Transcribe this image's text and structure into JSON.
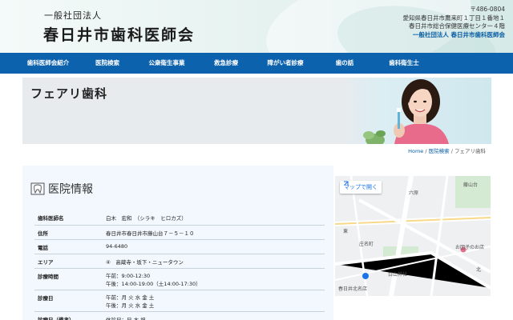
{
  "header": {
    "org_sub": "一般社団法人",
    "org_name": "春日井市歯科医師会",
    "postal": "〒486-0804",
    "address1": "愛知県春日井市鷹来町１丁目１番地１",
    "address2": "春日井市総合保健医療センター４階",
    "address_org": "一般社団法人 春日井市歯科医師会"
  },
  "nav": [
    "歯科医師会紹介",
    "医院検索",
    "公衆衛生事業",
    "救急診療",
    "障がい者診療",
    "歯の話",
    "歯科衛生士"
  ],
  "hero": {
    "title": "フェアリ歯科"
  },
  "breadcrumb": {
    "home": "Home",
    "sep1": "/",
    "search": "医院検索",
    "sep2": "/",
    "current": "フェアリ歯科"
  },
  "info": {
    "heading": "医院情報",
    "rows": {
      "director": {
        "label": "歯科医師名",
        "value": "白木　宏和　（シラキ　ヒロカズ）"
      },
      "address": {
        "label": "住所",
        "value": "春日井市春日井市藤山台７－５－１０"
      },
      "phone": {
        "label": "電話",
        "value": "94-6480"
      },
      "area": {
        "label": "エリア",
        "value": "④　高蔵寺・坂下・ニュータウン"
      },
      "hours": {
        "label": "診療時間",
        "line1": "午前：9:00-12:30",
        "line2": "午後：14:00-19:00（土14:00-17:30）"
      },
      "days": {
        "label": "診療日",
        "line1": "午前：月 火 水 金 土",
        "line2": "午後：月 火 水 金 土"
      },
      "holiday": {
        "label": "診療日（備考）",
        "value": "休診日：日 木 祝"
      }
    }
  },
  "map": {
    "open_label": "マップで開く",
    "labels": {
      "mt_fujiyama": "藤山台",
      "rohara": "六原",
      "higashi": "東",
      "shounen": "庄名町",
      "shiroyama": "白山神社",
      "otsu": "お団子のお店",
      "kita": "北",
      "kasugai": "春日井北名店"
    },
    "colors": {
      "road": "#ffffff",
      "water": "#aadaff",
      "park": "#d4ead3",
      "bg": "#eef0f2"
    }
  }
}
